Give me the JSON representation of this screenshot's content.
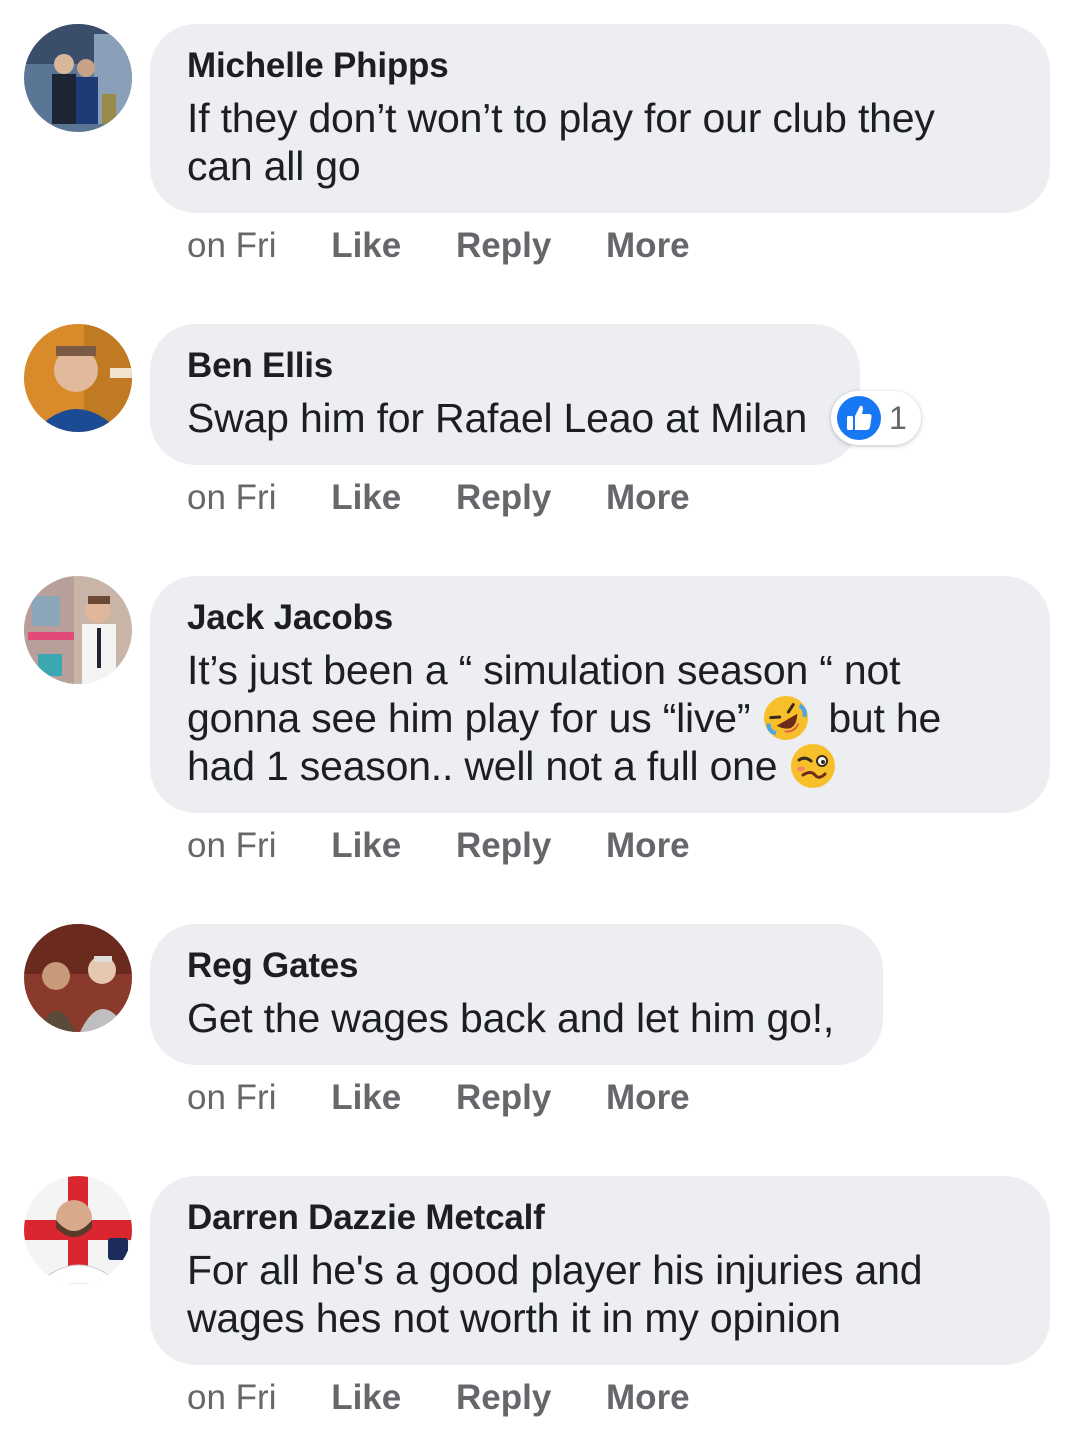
{
  "comments": [
    {
      "author": "Michelle Phipps",
      "text_lines": [
        "If they don’t won’t to play for our club they",
        "can all go"
      ],
      "time": "on Fri",
      "like": "Like",
      "reply": "Reply",
      "more": "More"
    },
    {
      "author": "Ben Ellis",
      "text": "Swap him for Rafael Leao at Milan",
      "reaction_count": "1",
      "reaction_icon": "like-thumbs-up-icon",
      "time": "on Fri",
      "like": "Like",
      "reply": "Reply",
      "more": "More"
    },
    {
      "author": "Jack Jacobs",
      "line1": "It’s just been a “ simulation season “ not",
      "line2a": "gonna see him play for us “live”",
      "line2b": "but he",
      "line3": "had 1 season.. well not a full one",
      "emojis": [
        "rolling-on-floor-laughing-emoji",
        "woozy-face-emoji"
      ],
      "time": "on Fri",
      "like": "Like",
      "reply": "Reply",
      "more": "More"
    },
    {
      "author": "Reg Gates",
      "text": "Get the wages back and let him go!,",
      "time": "on Fri",
      "like": "Like",
      "reply": "Reply",
      "more": "More"
    },
    {
      "author": "Darren Dazzie Metcalf",
      "text_lines": [
        "For all he's a good player his injuries and",
        "wages hes not worth it in my opinion"
      ],
      "time": "on Fri",
      "like": "Like",
      "reply": "Reply",
      "more": "More"
    }
  ],
  "colors": {
    "bubble": "#eceef2",
    "text": "#1c1e21",
    "secondary": "#65676b",
    "like_blue": "#1877f2"
  }
}
